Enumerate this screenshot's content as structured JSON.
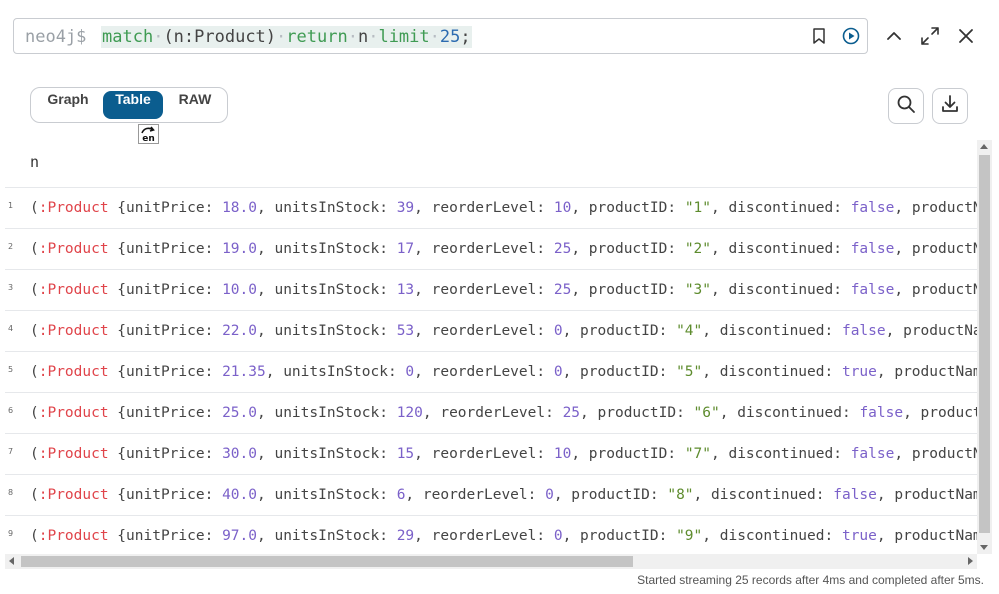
{
  "editor": {
    "prompt": "neo4j$",
    "query_tokens": [
      {
        "text": "match",
        "kind": "kw"
      },
      {
        "text": "·",
        "kind": "dot"
      },
      {
        "text": "(n:Product)",
        "kind": "ident"
      },
      {
        "text": "·",
        "kind": "dot"
      },
      {
        "text": "return",
        "kind": "kw"
      },
      {
        "text": "·",
        "kind": "dot"
      },
      {
        "text": "n",
        "kind": "ident"
      },
      {
        "text": "·",
        "kind": "dot"
      },
      {
        "text": "limit",
        "kind": "kw"
      },
      {
        "text": "·",
        "kind": "dot"
      },
      {
        "text": "25",
        "kind": "num"
      },
      {
        "text": ";",
        "kind": "ident"
      }
    ],
    "icons": [
      "bookmark-icon",
      "run-icon"
    ]
  },
  "window_controls": [
    "collapse-icon",
    "fullscreen-icon",
    "close-icon"
  ],
  "view_toggle": {
    "options": [
      "Graph",
      "Table",
      "RAW"
    ],
    "selected": "Table"
  },
  "toolbar_icons": [
    "search-icon",
    "download-icon"
  ],
  "translate_badge": "en",
  "results": {
    "column_header": "n",
    "rows": [
      {
        "num": "1",
        "tokens": [
          [
            "(",
            "p"
          ],
          [
            ":Product",
            "l"
          ],
          [
            " {unitPrice: ",
            "p"
          ],
          [
            "18.0",
            "n"
          ],
          [
            ", unitsInStock: ",
            "p"
          ],
          [
            "39",
            "n"
          ],
          [
            ", reorderLevel: ",
            "p"
          ],
          [
            "10",
            "n"
          ],
          [
            ", productID: ",
            "p"
          ],
          [
            "\"1\"",
            "s"
          ],
          [
            ", discontinued: ",
            "p"
          ],
          [
            "false",
            "b"
          ],
          [
            ", productName",
            "p"
          ]
        ]
      },
      {
        "num": "2",
        "tokens": [
          [
            "(",
            "p"
          ],
          [
            ":Product",
            "l"
          ],
          [
            " {unitPrice: ",
            "p"
          ],
          [
            "19.0",
            "n"
          ],
          [
            ", unitsInStock: ",
            "p"
          ],
          [
            "17",
            "n"
          ],
          [
            ", reorderLevel: ",
            "p"
          ],
          [
            "25",
            "n"
          ],
          [
            ", productID: ",
            "p"
          ],
          [
            "\"2\"",
            "s"
          ],
          [
            ", discontinued: ",
            "p"
          ],
          [
            "false",
            "b"
          ],
          [
            ", productName",
            "p"
          ]
        ]
      },
      {
        "num": "3",
        "tokens": [
          [
            "(",
            "p"
          ],
          [
            ":Product",
            "l"
          ],
          [
            " {unitPrice: ",
            "p"
          ],
          [
            "10.0",
            "n"
          ],
          [
            ", unitsInStock: ",
            "p"
          ],
          [
            "13",
            "n"
          ],
          [
            ", reorderLevel: ",
            "p"
          ],
          [
            "25",
            "n"
          ],
          [
            ", productID: ",
            "p"
          ],
          [
            "\"3\"",
            "s"
          ],
          [
            ", discontinued: ",
            "p"
          ],
          [
            "false",
            "b"
          ],
          [
            ", productName",
            "p"
          ]
        ]
      },
      {
        "num": "4",
        "tokens": [
          [
            "(",
            "p"
          ],
          [
            ":Product",
            "l"
          ],
          [
            " {unitPrice: ",
            "p"
          ],
          [
            "22.0",
            "n"
          ],
          [
            ", unitsInStock: ",
            "p"
          ],
          [
            "53",
            "n"
          ],
          [
            ", reorderLevel: ",
            "p"
          ],
          [
            "0",
            "n"
          ],
          [
            ", productID: ",
            "p"
          ],
          [
            "\"4\"",
            "s"
          ],
          [
            ", discontinued: ",
            "p"
          ],
          [
            "false",
            "b"
          ],
          [
            ", productName",
            "p"
          ]
        ]
      },
      {
        "num": "5",
        "tokens": [
          [
            "(",
            "p"
          ],
          [
            ":Product",
            "l"
          ],
          [
            " {unitPrice: ",
            "p"
          ],
          [
            "21.35",
            "n"
          ],
          [
            ", unitsInStock: ",
            "p"
          ],
          [
            "0",
            "n"
          ],
          [
            ", reorderLevel: ",
            "p"
          ],
          [
            "0",
            "n"
          ],
          [
            ", productID: ",
            "p"
          ],
          [
            "\"5\"",
            "s"
          ],
          [
            ", discontinued: ",
            "p"
          ],
          [
            "true",
            "b"
          ],
          [
            ", productName",
            "p"
          ]
        ]
      },
      {
        "num": "6",
        "tokens": [
          [
            "(",
            "p"
          ],
          [
            ":Product",
            "l"
          ],
          [
            " {unitPrice: ",
            "p"
          ],
          [
            "25.0",
            "n"
          ],
          [
            ", unitsInStock: ",
            "p"
          ],
          [
            "120",
            "n"
          ],
          [
            ", reorderLevel: ",
            "p"
          ],
          [
            "25",
            "n"
          ],
          [
            ", productID: ",
            "p"
          ],
          [
            "\"6\"",
            "s"
          ],
          [
            ", discontinued: ",
            "p"
          ],
          [
            "false",
            "b"
          ],
          [
            ", productName",
            "p"
          ]
        ]
      },
      {
        "num": "7",
        "tokens": [
          [
            "(",
            "p"
          ],
          [
            ":Product",
            "l"
          ],
          [
            " {unitPrice: ",
            "p"
          ],
          [
            "30.0",
            "n"
          ],
          [
            ", unitsInStock: ",
            "p"
          ],
          [
            "15",
            "n"
          ],
          [
            ", reorderLevel: ",
            "p"
          ],
          [
            "10",
            "n"
          ],
          [
            ", productID: ",
            "p"
          ],
          [
            "\"7\"",
            "s"
          ],
          [
            ", discontinued: ",
            "p"
          ],
          [
            "false",
            "b"
          ],
          [
            ", productName",
            "p"
          ]
        ]
      },
      {
        "num": "8",
        "tokens": [
          [
            "(",
            "p"
          ],
          [
            ":Product",
            "l"
          ],
          [
            " {unitPrice: ",
            "p"
          ],
          [
            "40.0",
            "n"
          ],
          [
            ", unitsInStock: ",
            "p"
          ],
          [
            "6",
            "n"
          ],
          [
            ", reorderLevel: ",
            "p"
          ],
          [
            "0",
            "n"
          ],
          [
            ", productID: ",
            "p"
          ],
          [
            "\"8\"",
            "s"
          ],
          [
            ", discontinued: ",
            "p"
          ],
          [
            "false",
            "b"
          ],
          [
            ", productName",
            "p"
          ]
        ]
      },
      {
        "num": "9",
        "tokens": [
          [
            "(",
            "p"
          ],
          [
            ":Product",
            "l"
          ],
          [
            " {unitPrice: ",
            "p"
          ],
          [
            "97.0",
            "n"
          ],
          [
            ", unitsInStock: ",
            "p"
          ],
          [
            "29",
            "n"
          ],
          [
            ", reorderLevel: ",
            "p"
          ],
          [
            "0",
            "n"
          ],
          [
            ", productID: ",
            "p"
          ],
          [
            "\"9\"",
            "s"
          ],
          [
            ", discontinued: ",
            "p"
          ],
          [
            "true",
            "b"
          ],
          [
            ", productName",
            "p"
          ]
        ]
      }
    ]
  },
  "status_text": "Started streaming 25 records after 4ms and completed after 5ms."
}
